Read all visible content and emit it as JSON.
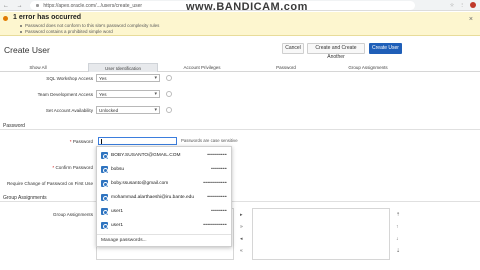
{
  "browser": {
    "url": "https://apex.oracle.com/.../users/create_user",
    "nav_arrows": "← → ↻",
    "toolbar_icons": "☆ ⋮"
  },
  "watermark": "www.BANDICAM.com",
  "error_banner": {
    "title": "1 error has occurred",
    "lines": [
      "Password does not conform to this site's password complexity rules",
      "Password contains a prohibited simple word"
    ],
    "close": "×"
  },
  "header": {
    "title": "Create User",
    "buttons": {
      "cancel": "Cancel",
      "create_another": "Create and Create Another",
      "create": "Create User"
    }
  },
  "tabs": [
    "Show All",
    "User Identification",
    "Account Privileges",
    "Password",
    "Group Assignments"
  ],
  "privileges": {
    "sql_workshop": {
      "label": "SQL Workshop Access",
      "value": "Yes"
    },
    "team_dev": {
      "label": "Team Development Access",
      "value": "Yes"
    },
    "account_availability": {
      "label": "Set Account Availability",
      "value": "Unlocked"
    }
  },
  "password_section": {
    "title": "Password",
    "password_label": "Password",
    "confirm_label": "Confirm Password",
    "change_label": "Require Change of Password on First Use",
    "hint": "Passwords are case sensitive",
    "required_marker": "*"
  },
  "autocomplete": {
    "items": [
      {
        "user": "BOBY.SUSANTO@GMAIL.COM",
        "masked": "••••••••••"
      },
      {
        "user": "bobsu",
        "masked": "••••••••"
      },
      {
        "user": "boby.ssusanto@gmail.com",
        "masked": "••••••••••••"
      },
      {
        "user": "mohammad.alarthaeshi@iru.bante.edu",
        "masked": "••••••••••"
      },
      {
        "user": "user1",
        "masked": "••••••••"
      },
      {
        "user": "user1",
        "masked": "••••••••••••"
      }
    ],
    "manage": "Manage passwords..."
  },
  "groups_section": {
    "title": "Group Assignments",
    "label": "Group Assignments"
  },
  "colors": {
    "primary": "#1f5fb8",
    "banner": "#fdf6cf",
    "warning": "#e07a00"
  }
}
